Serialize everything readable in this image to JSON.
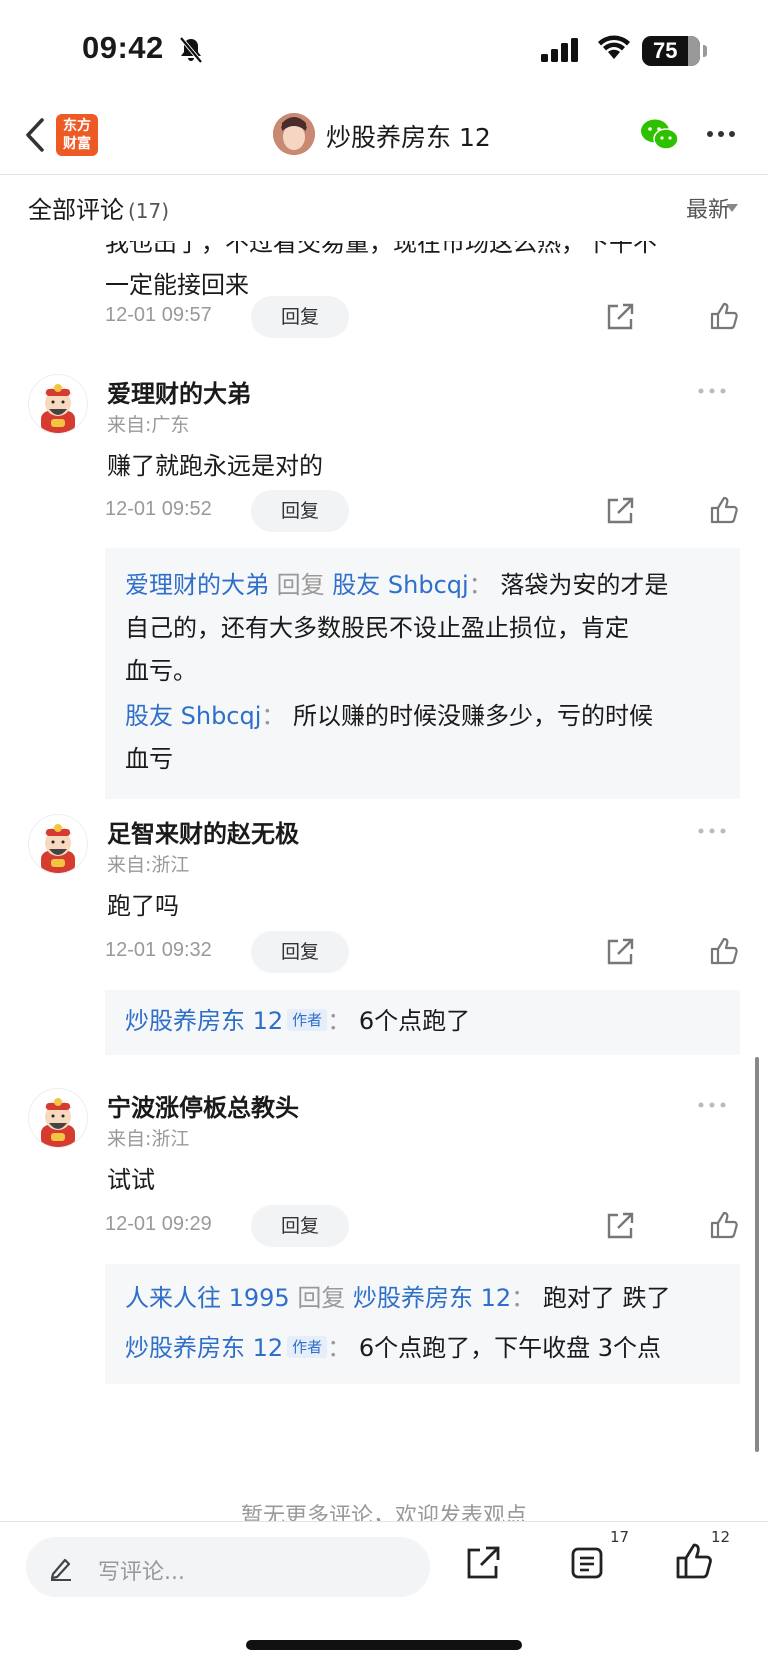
{
  "status_bar": {
    "time": "09:42",
    "battery": "75"
  },
  "nav": {
    "logo_line1": "东方",
    "logo_line2": "财富",
    "title": "炒股养房东 12"
  },
  "section": {
    "label": "全部评论",
    "count": "(17)",
    "sort": "最新"
  },
  "partial_comment": {
    "text_line1": "我也出了，不过看交易量，现在市场这么热，下午不",
    "text_line2": "一定能接回来",
    "date": "12-01 09:57",
    "reply_label": "回复"
  },
  "comments": [
    {
      "name": "爱理财的大弟",
      "source": "来自:广东",
      "text": "赚了就跑永远是对的",
      "date": "12-01 09:52",
      "reply_label": "回复",
      "replies": [
        {
          "from": "爱理财的大弟",
          "reply_word": "回复",
          "to": "股友 Shbcqj",
          "sep": "：",
          "text_a": "落袋为安的才是",
          "text_b": "自己的，还有大多数股民不设止盈止损位，肯定",
          "text_c": "血亏。"
        },
        {
          "from": "股友 Shbcqj",
          "sep": "：",
          "text_a": "所以赚的时候没赚多少，亏的时候",
          "text_b": "血亏"
        }
      ]
    },
    {
      "name": "足智来财的赵无极",
      "source": "来自:浙江",
      "text": "跑了吗",
      "date": "12-01 09:32",
      "reply_label": "回复",
      "replies": [
        {
          "from": "炒股养房东 12",
          "tag": "作者",
          "sep": "：",
          "text_a": "6个点跑了"
        }
      ]
    },
    {
      "name": "宁波涨停板总教头",
      "source": "来自:浙江",
      "text": "试试",
      "date": "12-01 09:29",
      "reply_label": "回复",
      "replies": [
        {
          "from": "人来人往 1995",
          "reply_word": "回复",
          "to": "炒股养房东 12",
          "sep": "：",
          "text_a": "跑对了 跌了"
        },
        {
          "from": "炒股养房东 12",
          "tag": "作者",
          "sep": "：",
          "text_a": "6个点跑了，下午收盘 3个点"
        }
      ]
    }
  ],
  "no_more": "暂无更多评论，欢迎发表观点",
  "bottom_bar": {
    "placeholder": "写评论...",
    "comment_count": "17",
    "like_count": "12"
  },
  "colors": {
    "link_blue": "#2e6fc9",
    "logo_orange": "#ee5a24",
    "wechat_green": "#2dc100"
  }
}
